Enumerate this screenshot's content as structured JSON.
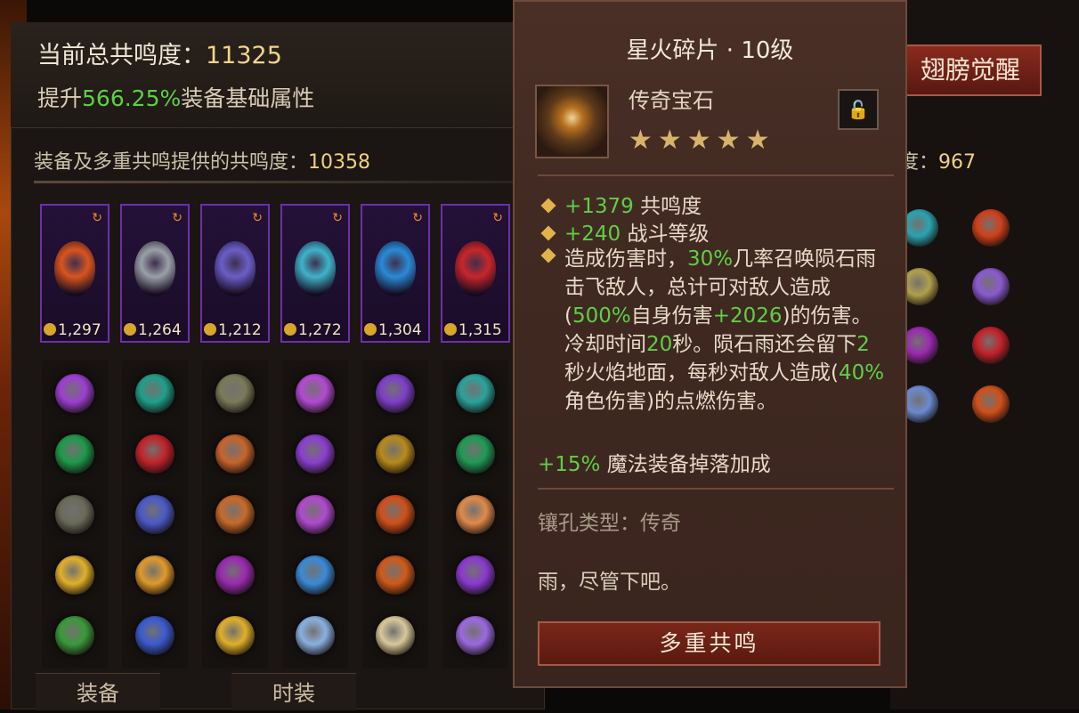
{
  "summary": {
    "total_label": "当前总共鸣度：",
    "total_value": "11325",
    "boost_prefix": "提升",
    "boost_value": "566.25%",
    "boost_suffix": "装备基础属性"
  },
  "sources": {
    "gear_label": "装备及多重共鸣提供的共鸣度：",
    "gear_value": "10358",
    "right_label": "度：",
    "right_value": "967"
  },
  "gear_cards": [
    {
      "value": "1,297",
      "color": "#d8551f"
    },
    {
      "value": "1,264",
      "color": "#9aa0a8"
    },
    {
      "value": "1,212",
      "color": "#6b5ec7"
    },
    {
      "value": "1,272",
      "color": "#3fb3c9"
    },
    {
      "value": "1,304",
      "color": "#2a8ad6"
    },
    {
      "value": "1,315",
      "color": "#c8262a"
    }
  ],
  "wing_button": "翅膀觉醒",
  "tabs": {
    "equip": "装备",
    "fashion": "时装"
  },
  "tooltip": {
    "title": "星火碎片 · 10级",
    "type": "传奇宝石",
    "stars": "★★★★★",
    "lock_icon": "lock-icon",
    "stats": [
      {
        "value": "+1379",
        "label": " 共鸣度"
      },
      {
        "value": "+240",
        "label": " 战斗等级"
      }
    ],
    "desc_parts": {
      "p1": "造成伤害时，",
      "p2": "30%",
      "p3": "几率召唤陨石雨击飞敌人，总计可对敌人造成(",
      "p4": "500%",
      "p5": "自身伤害",
      "p6": "+2026",
      "p7": ")的伤害。冷却时间",
      "p8": "20",
      "p9": "秒。陨石雨还会留下",
      "p10": "2",
      "p11": "秒火焰地面，每秒对敌人造成(",
      "p12": "40%",
      "p13": "角色伤害)的点燃伤害。"
    },
    "drop_value": "+15%",
    "drop_label": " 魔法装备掉落加成",
    "socket": "镶孔类型：传奇",
    "flavor": "雨，尽管下吧。",
    "button": "多重共鸣"
  }
}
